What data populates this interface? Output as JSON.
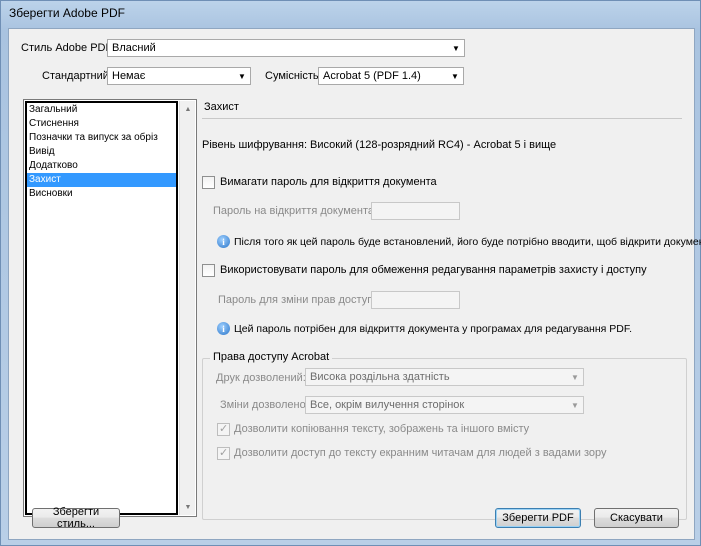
{
  "window": {
    "title": "Зберегти Adobe PDF"
  },
  "style_row": {
    "label": "Стиль Adobe PDF:",
    "value": "Власний"
  },
  "standard_row": {
    "label": "Стандартний:",
    "value": "Немає"
  },
  "compat_row": {
    "label": "Сумісність:",
    "value": "Acrobat 5 (PDF 1.4)"
  },
  "sidebar": {
    "items": [
      {
        "label": "Загальний"
      },
      {
        "label": "Стиснення"
      },
      {
        "label": "Позначки та випуск за обріз"
      },
      {
        "label": "Вивід"
      },
      {
        "label": "Додатково"
      },
      {
        "label": "Захист"
      },
      {
        "label": "Висновки"
      }
    ],
    "selected_index": 5
  },
  "panel": {
    "title": "Захист",
    "encryption_text": "Рівень шифрування:   Високий (128-розрядний RC4) - Acrobat 5 і вище",
    "open_password": {
      "checkbox_label": "Вимагати пароль для відкриття документа",
      "field_label": "Пароль на відкриття документа:",
      "field_value": "",
      "info": "Після того як цей пароль буде встановлений, його буде потрібно вводити, щоб відкрити документ."
    },
    "permissions_password": {
      "checkbox_label": "Використовувати пароль для обмеження редагування параметрів захисту і доступу",
      "field_label": "Пароль для зміни прав доступу:",
      "field_value": "",
      "info": "Цей пароль потрібен для відкриття документа у програмах для редагування PDF."
    },
    "acrobat_rights": {
      "legend": "Права доступу Acrobat",
      "print_label": "Друк дозволений:",
      "print_value": "Висока роздільна здатність",
      "changes_label": "Зміни дозволено:",
      "changes_value": "Все, окрім вилучення сторінок",
      "copy_label": "Дозволити копіювання тексту, зображень та іншого вмісту",
      "screenreader_label": "Дозволити доступ до тексту екранним читачам для людей з вадами зору"
    }
  },
  "footer": {
    "save_style_button": "Зберегти стиль...",
    "save_pdf_button": "Зберегти PDF",
    "cancel_button": "Скасувати"
  }
}
